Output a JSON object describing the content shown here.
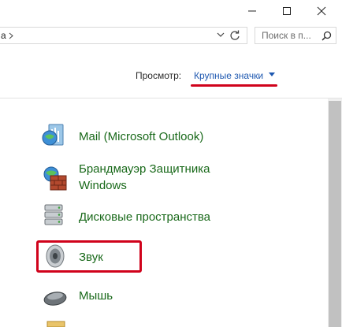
{
  "window": {
    "controls": [
      "minimize",
      "maximize",
      "close"
    ]
  },
  "address": {
    "path_fragment": "a",
    "chevron_icon": "chevron-right-icon",
    "dropdown_icon": "chevron-down-icon",
    "refresh_icon": "refresh-icon"
  },
  "search": {
    "placeholder": "Поиск в п..."
  },
  "view": {
    "label": "Просмотр:",
    "value": "Крупные значки"
  },
  "items": [
    {
      "label": "Mail (Microsoft Outlook)",
      "icon": "mail-icon"
    },
    {
      "label_line1": "Брандмауэр Защитника",
      "label_line2": "Windows",
      "icon": "firewall-icon"
    },
    {
      "label": "Дисковые пространства",
      "icon": "storage-spaces-icon"
    },
    {
      "label": "Звук",
      "icon": "sound-icon"
    },
    {
      "label": "Мышь",
      "icon": "mouse-icon"
    },
    {
      "label": "",
      "icon": "folder-icon"
    }
  ],
  "colors": {
    "link_green": "#19691a",
    "view_blue": "#1e58b0",
    "annotation_red": "#d0021b"
  }
}
